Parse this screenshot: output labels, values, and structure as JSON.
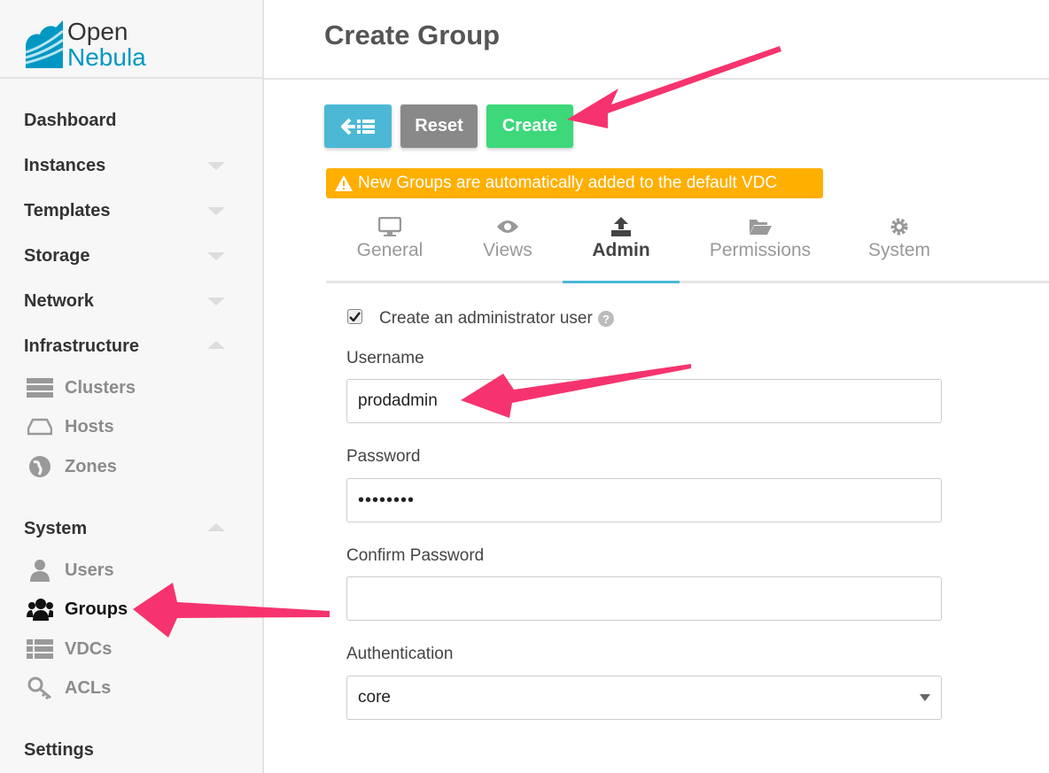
{
  "logo": {
    "line1": "Open",
    "line2": "Nebula"
  },
  "sidebar": {
    "sections": [
      {
        "label": "Dashboard"
      },
      {
        "label": "Instances"
      },
      {
        "label": "Templates"
      },
      {
        "label": "Storage"
      },
      {
        "label": "Network"
      },
      {
        "label": "Infrastructure"
      }
    ],
    "infra_items": [
      {
        "label": "Clusters",
        "icon": "server-icon"
      },
      {
        "label": "Hosts",
        "icon": "hdd-icon"
      },
      {
        "label": "Zones",
        "icon": "globe-icon"
      }
    ],
    "system": "System",
    "system_items": [
      {
        "label": "Users",
        "icon": "user-icon"
      },
      {
        "label": "Groups",
        "icon": "users-icon",
        "active": true
      },
      {
        "label": "VDCs",
        "icon": "list-icon"
      },
      {
        "label": "ACLs",
        "icon": "key-icon"
      }
    ],
    "settings": "Settings"
  },
  "header": {
    "title": "Create Group"
  },
  "toolbar": {
    "back_icon": "arrow-left-list-icon",
    "reset": "Reset",
    "create": "Create"
  },
  "warning": {
    "icon": "warning-icon",
    "text": "New Groups are automatically added to the default VDC"
  },
  "tabs": [
    {
      "label": "General",
      "icon": "desktop-icon"
    },
    {
      "label": "Views",
      "icon": "eye-icon"
    },
    {
      "label": "Admin",
      "icon": "upload-icon",
      "active": true
    },
    {
      "label": "Permissions",
      "icon": "folder-open-icon"
    },
    {
      "label": "System",
      "icon": "gear-icon"
    }
  ],
  "form": {
    "create_admin_label": "Create an administrator user",
    "create_admin_checked": true,
    "username_label": "Username",
    "username_value": "prodadmin",
    "password_label": "Password",
    "password_value": "••••••••",
    "confirm_label": "Confirm Password",
    "confirm_value": "",
    "auth_label": "Authentication",
    "auth_value": "core"
  },
  "colors": {
    "accent": "#4cb8d5",
    "reset": "#898989",
    "create": "#3cd87a",
    "warning": "#ffaf00",
    "annotation": "#f6336e"
  }
}
